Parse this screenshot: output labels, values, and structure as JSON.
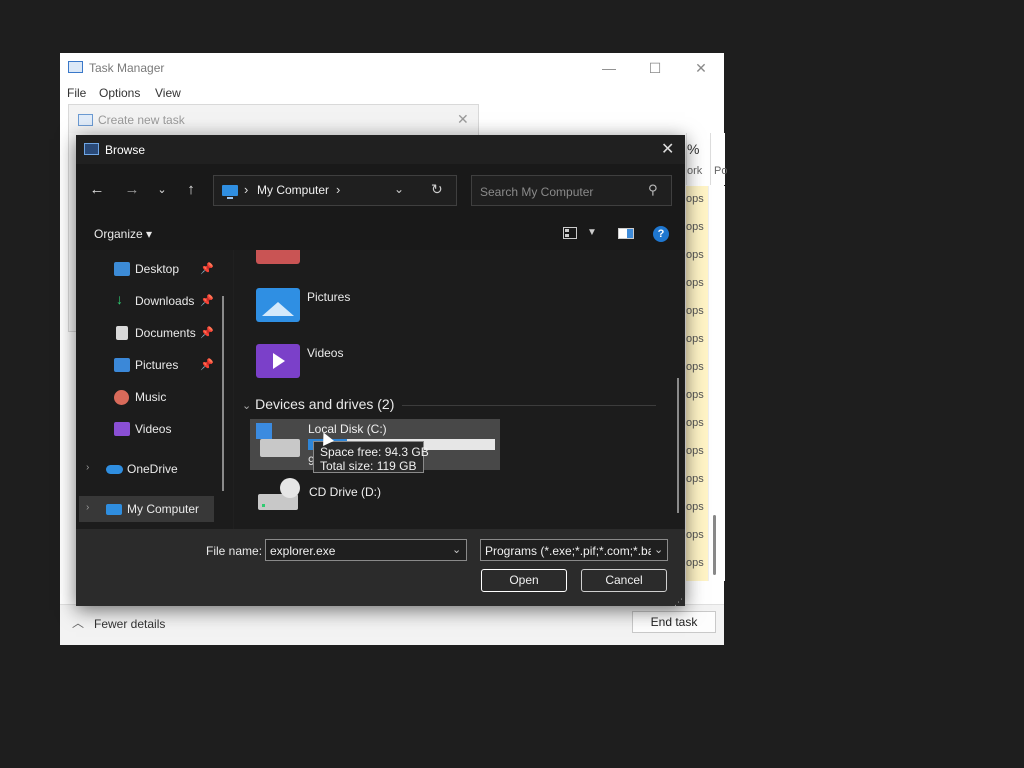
{
  "task_manager": {
    "title": "Task Manager",
    "menu": [
      "File",
      "Options",
      "View"
    ],
    "window_controls": {
      "minimize": "—",
      "maximize": "☐",
      "close": "✕"
    },
    "column": {
      "percent": "%",
      "label": "ork",
      "label2": "Po"
    },
    "row_values": [
      "ops",
      "ops",
      "ops",
      "ops",
      "ops",
      "ops",
      "ops",
      "ops",
      "ops",
      "ops",
      "ops",
      "ops",
      "ops",
      "ops"
    ],
    "fewer_details": "Fewer details",
    "end_task": "End task"
  },
  "create_new_task": {
    "title": "Create new task",
    "close": "✕"
  },
  "browse": {
    "title": "Browse",
    "close": "✕",
    "address": {
      "crumb": "My Computer"
    },
    "search": {
      "placeholder": "Search My Computer"
    },
    "organize": "Organize ▾",
    "help": "?",
    "nav": {
      "items": [
        {
          "label": "Desktop",
          "pinned": true
        },
        {
          "label": "Downloads",
          "pinned": true
        },
        {
          "label": "Documents",
          "pinned": true
        },
        {
          "label": "Pictures",
          "pinned": true
        },
        {
          "label": "Music",
          "pinned": false
        },
        {
          "label": "Videos",
          "pinned": false
        },
        {
          "label": "OneDrive",
          "pinned": false
        },
        {
          "label": "My Computer",
          "pinned": false
        }
      ]
    },
    "content": {
      "folders": [
        "Pictures",
        "Videos"
      ],
      "group_title": "Devices and drives (2)",
      "drives": [
        {
          "name": "Local Disk (C:)",
          "used_fraction": 0.21,
          "partial_caption": "9"
        },
        {
          "name": "CD Drive (D:)"
        }
      ]
    },
    "tooltip": {
      "space_free": "Space free: 94.3 GB",
      "total_size": "Total size: 119 GB"
    },
    "bottom": {
      "file_name_label": "File name:",
      "file_name_value": "explorer.exe",
      "filter_value": "Programs (*.exe;*.pif;*.com;*.bat)",
      "open_label": "Open",
      "cancel_label": "Cancel"
    }
  }
}
